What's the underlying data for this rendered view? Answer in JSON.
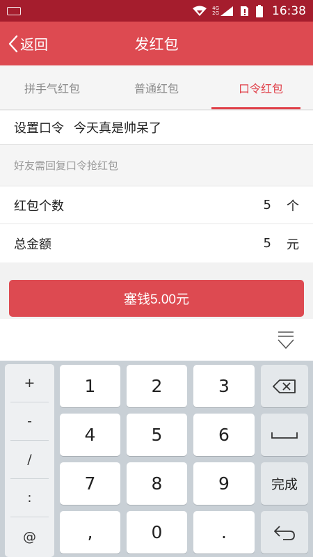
{
  "status_bar": {
    "time": "16:38",
    "network_top": "4G",
    "network_bottom": "2G"
  },
  "nav": {
    "back_label": "返回",
    "title": "发红包"
  },
  "tabs": [
    {
      "label": "拼手气红包",
      "active": false
    },
    {
      "label": "普通红包",
      "active": false
    },
    {
      "label": "口令红包",
      "active": true
    }
  ],
  "form": {
    "passcode_label": "设置口令",
    "passcode_value": "今天真是帅呆了",
    "hint": "好友需回复口令抢红包",
    "count_label": "红包个数",
    "count_value": "5",
    "count_unit": "个",
    "amount_label": "总金额",
    "amount_value": "5",
    "amount_unit": "元"
  },
  "pay_button": "塞钱5.00元",
  "keyboard": {
    "symbols": [
      "+",
      "-",
      "/",
      ":",
      "@"
    ],
    "digits": [
      "1",
      "2",
      "3",
      "4",
      "5",
      "6",
      "7",
      "8",
      "9",
      ",",
      "0",
      "."
    ],
    "done_label": "完成",
    "icons": [
      "backspace-icon",
      "space-icon",
      "enter-icon",
      "hide-keyboard-icon"
    ]
  },
  "colors": {
    "status_bar": "#a51d2d",
    "nav_bar": "#dd4a51",
    "active_tab": "#e03f48",
    "button": "#dd4a51"
  }
}
